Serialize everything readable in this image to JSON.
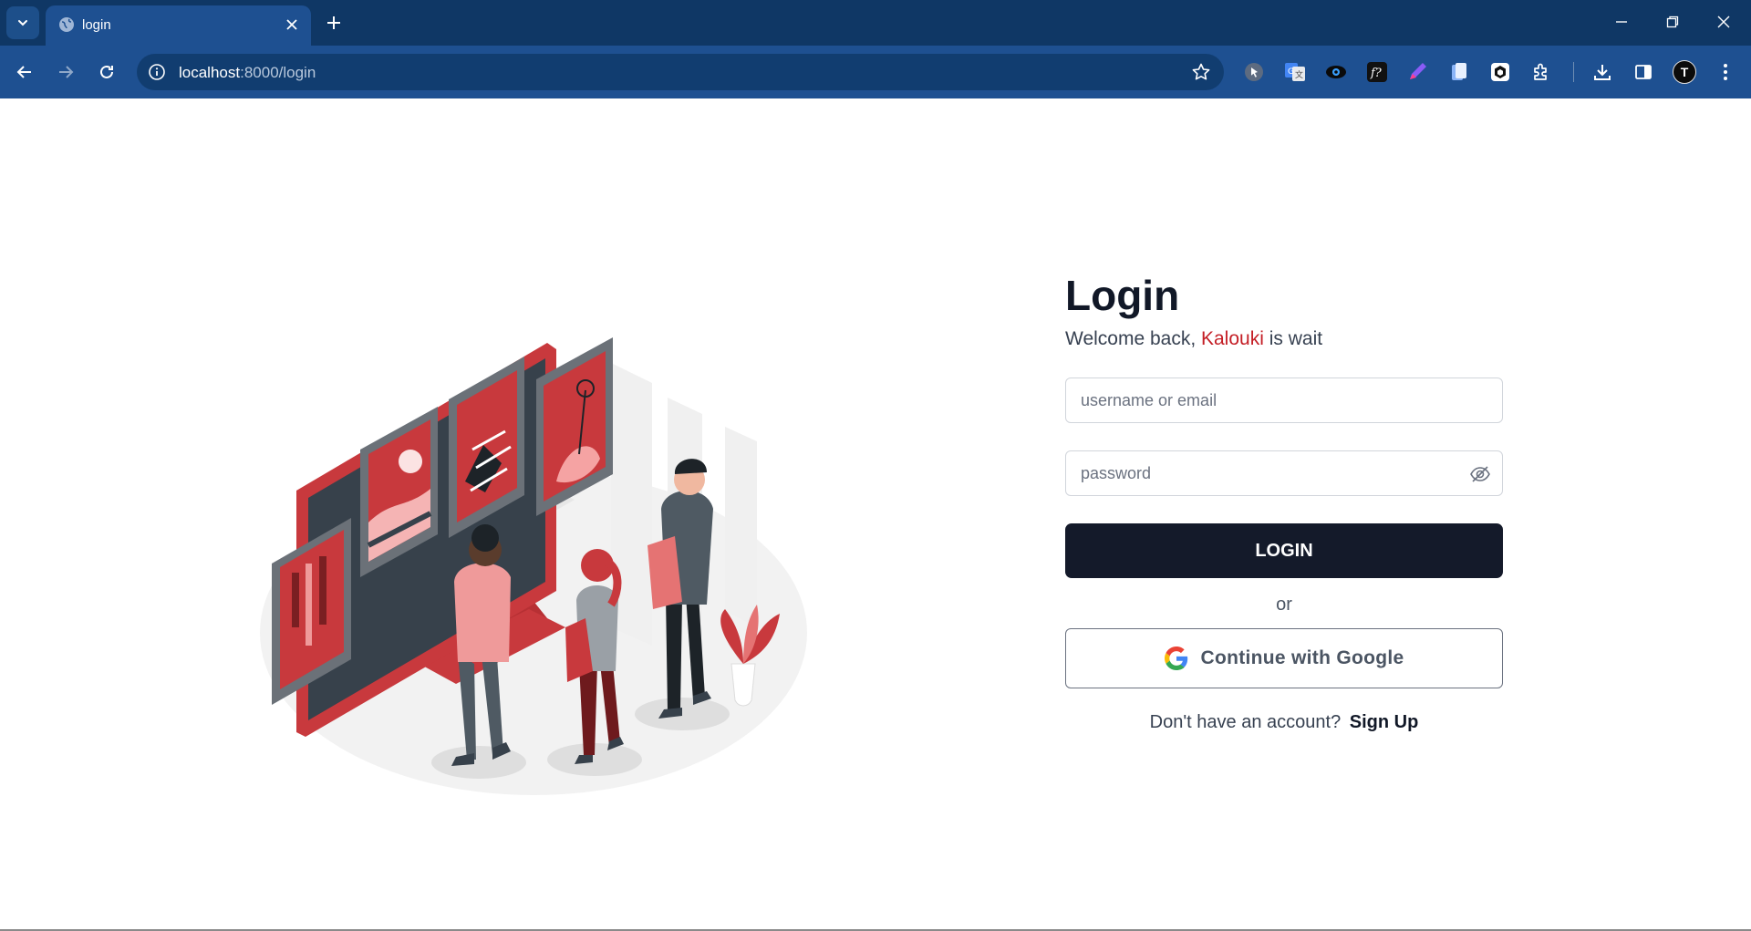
{
  "browser": {
    "tab_title": "login",
    "url_host": "localhost",
    "url_path": ":8000/login",
    "avatar_initial": "T",
    "colors": {
      "tabbar": "#0f3765",
      "toolbar": "#1e5091",
      "omnibox": "#113d70"
    }
  },
  "login": {
    "title": "Login",
    "welcome_prefix": "Welcome back, ",
    "brand": "Kalouki",
    "welcome_suffix": " is wait",
    "username_placeholder": "username or email",
    "password_placeholder": "password",
    "login_button": "LOGIN",
    "or_text": "or",
    "google_button": "Continue with Google",
    "signup_prompt": "Don't have an account?",
    "signup_link": "Sign Up"
  },
  "colors": {
    "primary_button": "#141a2a",
    "brand_accent": "#c41e25",
    "illustration_red": "#c8393d"
  },
  "icons": [
    "tab-search-icon",
    "globe-icon",
    "close-icon",
    "plus-icon",
    "minimize-icon",
    "restore-icon",
    "back-icon",
    "forward-icon",
    "reload-icon",
    "info-icon",
    "star-icon",
    "eye-off-icon",
    "google-icon"
  ]
}
